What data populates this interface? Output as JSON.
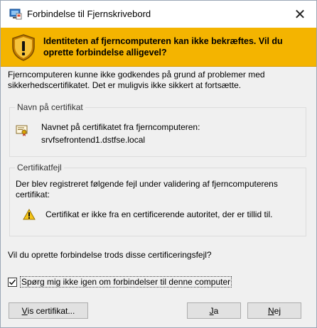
{
  "window": {
    "title": "Forbindelse til Fjernskrivebord",
    "close_glyph": "✕"
  },
  "banner": {
    "text": "Identiteten af fjerncomputeren kan ikke bekræftes. Vil du oprette forbindelse alligevel?",
    "color": "#f4b400"
  },
  "intro_text": "Fjerncomputeren kunne ikke godkendes på grund af problemer med sikkerhedscertifikatet. Det er muligvis ikke sikkert at fortsætte.",
  "certificate_group": {
    "legend": "Navn på certifikat",
    "line1": "Navnet på certifikatet fra fjerncomputeren:",
    "line2": "srvfsefrontend1.dstfse.local"
  },
  "error_group": {
    "legend": "Certifikatfejl",
    "description": "Der blev registreret følgende fejl under validering af fjerncomputerens certifikat:",
    "error_item": "Certifikat er ikke fra en certificerende autoritet, der er tillid til."
  },
  "question": "Vil du oprette forbindelse trods disse certificeringsfejl?",
  "checkbox": {
    "label": "Spørg mig ikke igen om forbindelser til denne computer",
    "checked": true
  },
  "buttons": {
    "view_cert_mnemonic": "V",
    "view_cert_rest": "is certifikat...",
    "yes_mnemonic": "J",
    "yes_rest": "a",
    "no_mnemonic": "N",
    "no_rest": "ej"
  },
  "icons": {
    "app": "remote-desktop-icon",
    "banner": "warning-shield-icon",
    "certificate": "certificate-icon",
    "error": "warning-triangle-icon"
  }
}
